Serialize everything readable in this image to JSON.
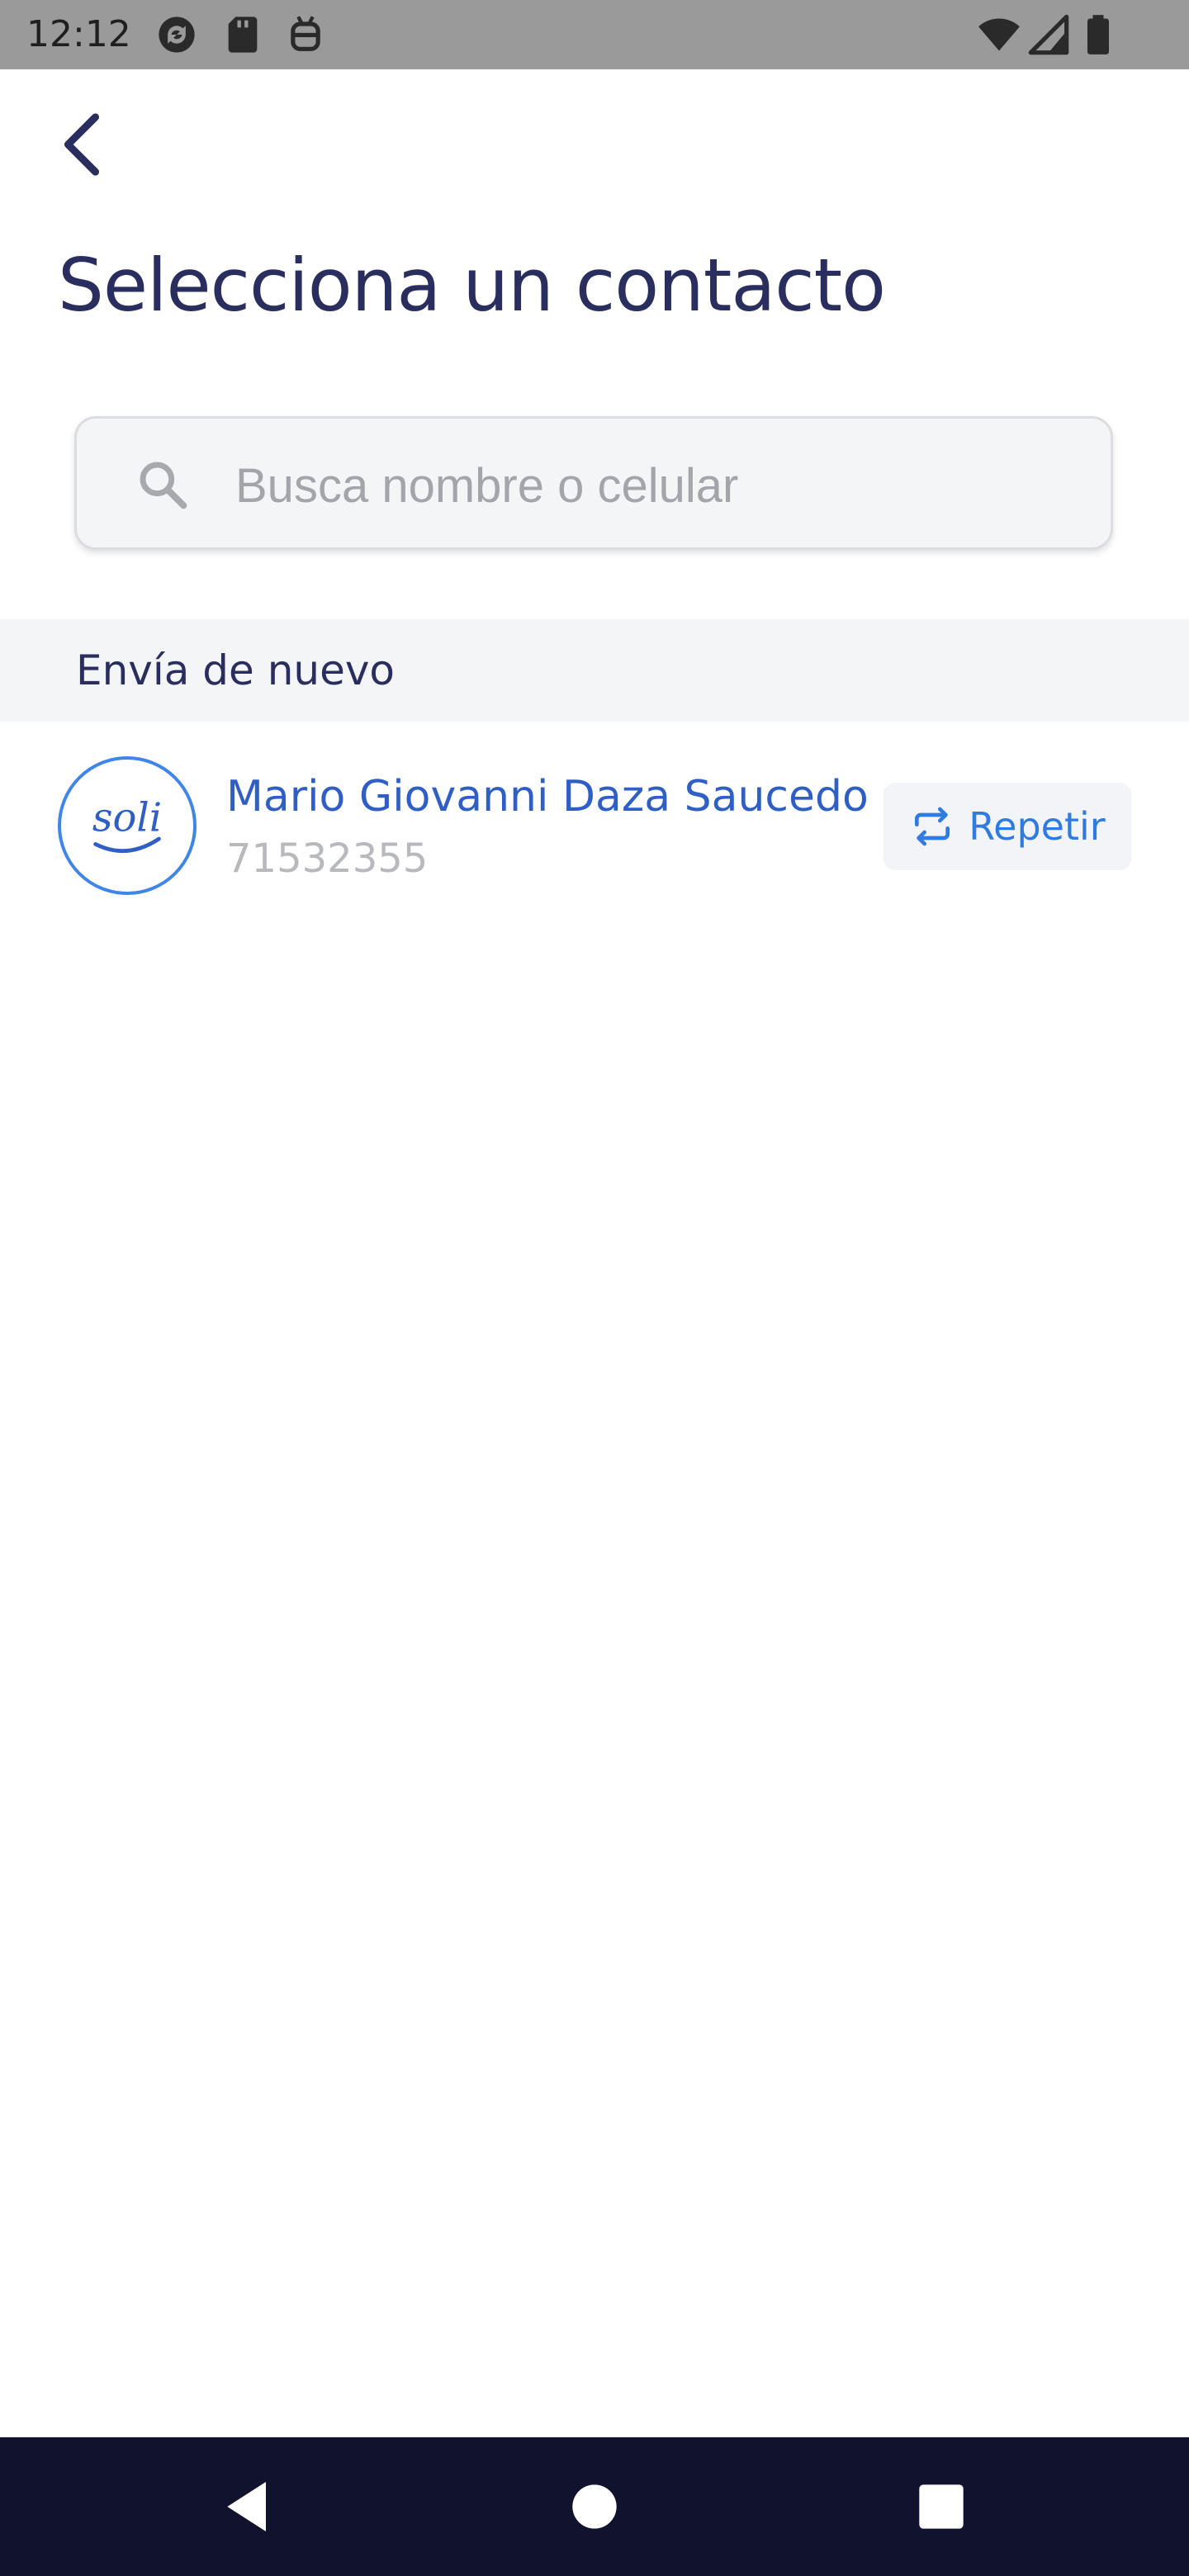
{
  "status_bar": {
    "time": "12:12",
    "icons": [
      "sync-icon",
      "sd-card-icon",
      "android-debug-icon",
      "wifi-icon",
      "cell-signal-icon",
      "battery-icon"
    ]
  },
  "header": {
    "back_icon": "chevron-left-icon",
    "title": "Selecciona un contacto"
  },
  "search": {
    "icon": "search-icon",
    "placeholder": "Busca nombre o celular",
    "value": ""
  },
  "recent_section": {
    "title": "Envía de nuevo",
    "contacts": [
      {
        "avatar_text": "soli",
        "name": "Mario Giovanni Daza Saucedo",
        "phone": "71532355",
        "action_label": "Repetir",
        "action_icon": "repeat-icon"
      }
    ]
  },
  "colors": {
    "title": "#2a2e5e",
    "accent": "#2f7be0",
    "name": "#2f5fc4",
    "muted": "#b8b9bd",
    "section_bg": "#f4f5f7",
    "nav_bar": "#10122e"
  },
  "nav_bar": {
    "buttons": [
      "back-triangle-icon",
      "home-circle-icon",
      "recents-square-icon"
    ]
  }
}
